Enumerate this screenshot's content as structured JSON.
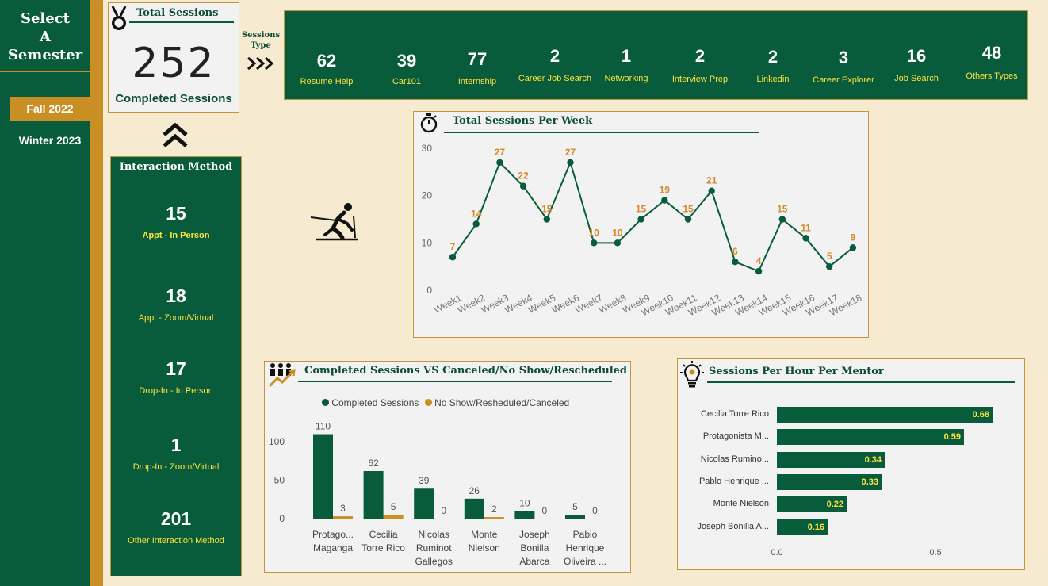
{
  "sidebar": {
    "title_lines": [
      "Select",
      "A",
      "Semester"
    ],
    "semesters": [
      {
        "label": "Fall 2022",
        "active": true
      },
      {
        "label": "Winter 2023",
        "active": false
      }
    ]
  },
  "total_sessions": {
    "title": "Total Sessions",
    "value": "252",
    "subtitle": "Completed Sessions"
  },
  "sessions_type": {
    "label_lines": [
      "Sessions",
      "Type"
    ],
    "items": [
      {
        "value": "62",
        "label": "Resume Help"
      },
      {
        "value": "39",
        "label": "Car101"
      },
      {
        "value": "77",
        "label": "Internship"
      },
      {
        "value": "2",
        "label": "Career Job Search"
      },
      {
        "value": "1",
        "label": "Networking"
      },
      {
        "value": "2",
        "label": "Interview Prep"
      },
      {
        "value": "2",
        "label": "Linkedin"
      },
      {
        "value": "3",
        "label": "Career Explorer"
      },
      {
        "value": "16",
        "label": "Job Search"
      },
      {
        "value": "48",
        "label": "Others Types"
      }
    ]
  },
  "interaction_method": {
    "title": "Interaction Method",
    "items": [
      {
        "value": "15",
        "label": "Appt - In Person"
      },
      {
        "value": "18",
        "label": "Appt - Zoom/Virtual"
      },
      {
        "value": "17",
        "label": "Drop-In - In Person"
      },
      {
        "value": "1",
        "label": "Drop-In - Zoom/Virtual"
      },
      {
        "value": "201",
        "label": "Other Interaction Method"
      }
    ]
  },
  "icons": {
    "medal": "medal-icon",
    "stopwatch": "stopwatch-icon",
    "skier": "skier-icon",
    "team_growth": "team-growth-icon",
    "lightbulb": "lightbulb-gear-icon",
    "chevrons": "double-chevron-up-icon",
    "arrows": "triple-chevron-right-icon"
  },
  "colors": {
    "green": "#085c3c",
    "gold": "#c98f24",
    "orange_label": "#d4892a",
    "yellow_text": "#ffe23c",
    "background": "#f6ead1"
  },
  "chart_data": [
    {
      "type": "line",
      "title": "Total Sessions Per Week",
      "x": [
        "Week1",
        "Week2",
        "Week3",
        "Week4",
        "Week5",
        "Week6",
        "Week7",
        "Week8",
        "Week9",
        "Week10",
        "Week11",
        "Week12",
        "Week13",
        "Week14",
        "Week15",
        "Week16",
        "Week17",
        "Week18"
      ],
      "y": [
        7,
        14,
        27,
        22,
        15,
        27,
        10,
        10,
        15,
        19,
        15,
        21,
        6,
        4,
        15,
        11,
        5,
        9
      ],
      "yticks": [
        "0",
        "10",
        "20",
        "30"
      ],
      "ylim": [
        0,
        30
      ],
      "grid": false
    },
    {
      "type": "bar",
      "title": "Completed Sessions  VS Canceled/No Show/Rescheduled",
      "categories": [
        [
          "Protago...",
          "Maganga"
        ],
        [
          "Cecilia",
          "Torre Rico"
        ],
        [
          "Nicolas",
          "Ruminot",
          "Gallegos"
        ],
        [
          "Monte",
          "Nielson"
        ],
        [
          "Joseph",
          "Bonilla",
          "Abarca"
        ],
        [
          "Pablo",
          "Henrique",
          "Oliveira ..."
        ]
      ],
      "series": [
        {
          "name": "Completed Sessions",
          "values": [
            110,
            62,
            39,
            26,
            10,
            5
          ]
        },
        {
          "name": "No Show/Resheduled/Canceled",
          "values": [
            3,
            5,
            0,
            2,
            0,
            0
          ]
        }
      ],
      "yticks": [
        "0",
        "50",
        "100"
      ],
      "ylim": [
        0,
        125
      ],
      "legend": "top-center"
    },
    {
      "type": "bar",
      "orientation": "horizontal",
      "title": "Sessions Per Hour Per Mentor",
      "categories": [
        "Cecilia Torre Rico",
        "Protagonista M...",
        "Nicolas Rumino...",
        "Pablo Henrique ...",
        "Monte Nielson",
        "Joseph Bonilla A..."
      ],
      "values": [
        0.68,
        0.59,
        0.34,
        0.33,
        0.22,
        0.16
      ],
      "value_labels": [
        "0.68",
        "0.59",
        "0.34",
        "0.33",
        "0.22",
        "0.16"
      ],
      "xticks": [
        "0.0",
        "0.5"
      ],
      "xlim": [
        0,
        0.78
      ]
    }
  ]
}
